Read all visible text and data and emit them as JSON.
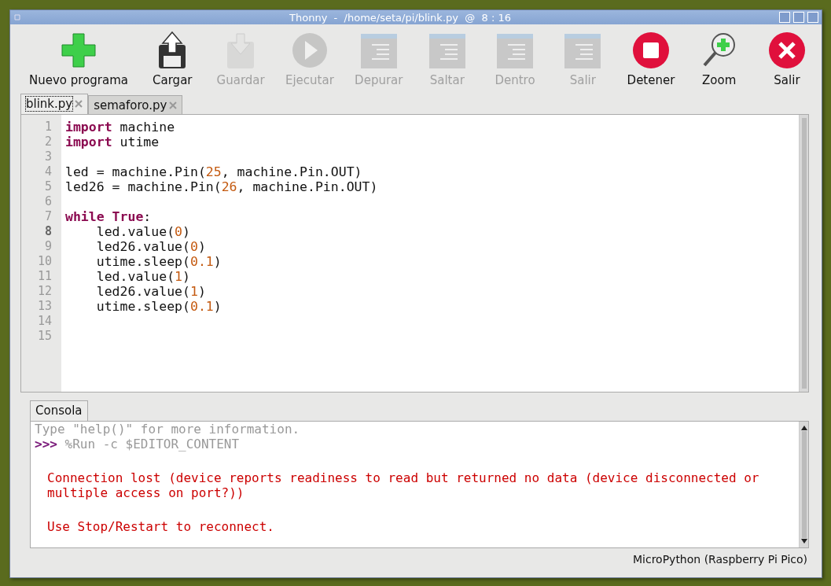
{
  "window": {
    "title": "Thonny  -  /home/seta/pi/blink.py  @  8 : 16"
  },
  "toolbar": [
    {
      "label": "Nuevo programa",
      "kind": "new",
      "disabled": false
    },
    {
      "label": "Cargar",
      "kind": "load",
      "disabled": false
    },
    {
      "label": "Guardar",
      "kind": "save",
      "disabled": true
    },
    {
      "label": "Ejecutar",
      "kind": "run",
      "disabled": true
    },
    {
      "label": "Depurar",
      "kind": "doc",
      "disabled": true
    },
    {
      "label": "Saltar",
      "kind": "doc",
      "disabled": true
    },
    {
      "label": "Dentro",
      "kind": "doc",
      "disabled": true
    },
    {
      "label": "Salir",
      "kind": "doc",
      "disabled": true
    },
    {
      "label": "Detener",
      "kind": "stop",
      "disabled": false
    },
    {
      "label": "Zoom",
      "kind": "zoom",
      "disabled": false
    },
    {
      "label": "Salir",
      "kind": "exit",
      "disabled": false
    }
  ],
  "editor_tabs": [
    {
      "label": "blink.py",
      "selected": true
    },
    {
      "label": "semaforo.py",
      "selected": false
    }
  ],
  "code_lines": [
    {
      "number": "1",
      "current": false,
      "tokens": [
        {
          "kind": "keyword",
          "text": "import"
        },
        {
          "kind": "plain",
          "text": " machine"
        }
      ]
    },
    {
      "number": "2",
      "current": false,
      "tokens": [
        {
          "kind": "keyword",
          "text": "import"
        },
        {
          "kind": "plain",
          "text": " utime"
        }
      ]
    },
    {
      "number": "3",
      "current": false
    },
    {
      "number": "4",
      "current": false,
      "tokens": [
        {
          "kind": "plain",
          "text": "led = machine.Pin("
        },
        {
          "kind": "number",
          "text": "25"
        },
        {
          "kind": "plain",
          "text": ", machine.Pin.OUT)"
        }
      ]
    },
    {
      "number": "5",
      "current": false,
      "tokens": [
        {
          "kind": "plain",
          "text": "led26 = machine.Pin("
        },
        {
          "kind": "number",
          "text": "26"
        },
        {
          "kind": "plain",
          "text": ", machine.Pin.OUT)"
        }
      ]
    },
    {
      "number": "6",
      "current": false
    },
    {
      "number": "7",
      "current": false,
      "tokens": [
        {
          "kind": "keyword",
          "text": "while True"
        },
        {
          "kind": "plain",
          "text": ":"
        }
      ]
    },
    {
      "number": "8",
      "current": true,
      "tokens": [
        {
          "kind": "plain",
          "text": "    led.value("
        },
        {
          "kind": "number",
          "text": "0"
        },
        {
          "kind": "plain",
          "text": ")"
        }
      ]
    },
    {
      "number": "9",
      "current": false,
      "tokens": [
        {
          "kind": "plain",
          "text": "    led26.value("
        },
        {
          "kind": "number",
          "text": "0"
        },
        {
          "kind": "plain",
          "text": ")"
        }
      ]
    },
    {
      "number": "10",
      "current": false,
      "tokens": [
        {
          "kind": "plain",
          "text": "    utime.sleep("
        },
        {
          "kind": "number",
          "text": "0.1"
        },
        {
          "kind": "plain",
          "text": ")"
        }
      ]
    },
    {
      "number": "11",
      "current": false,
      "tokens": [
        {
          "kind": "plain",
          "text": "    led.value("
        },
        {
          "kind": "number",
          "text": "1"
        },
        {
          "kind": "plain",
          "text": ")"
        }
      ]
    },
    {
      "number": "12",
      "current": false,
      "tokens": [
        {
          "kind": "plain",
          "text": "    led26.value("
        },
        {
          "kind": "number",
          "text": "1"
        },
        {
          "kind": "plain",
          "text": ")"
        }
      ]
    },
    {
      "number": "13",
      "current": false,
      "tokens": [
        {
          "kind": "plain",
          "text": "    utime.sleep("
        },
        {
          "kind": "number",
          "text": "0.1"
        },
        {
          "kind": "plain",
          "text": ")"
        }
      ]
    },
    {
      "number": "14",
      "current": false
    },
    {
      "number": "15",
      "current": false
    }
  ],
  "console_tab": {
    "label": "Consola",
    "selected": true
  },
  "console_lines": [
    {
      "kind": "info",
      "text": "Type \"help()\" for more information."
    },
    {
      "kind": "prompt",
      "prompt": ">>>",
      "text": " %Run -c $EDITOR_CONTENT"
    },
    {
      "kind": "blank"
    },
    {
      "kind": "error",
      "text": "Connection lost (device reports readiness to read but returned no data (device disconnected or multiple access on port?))"
    },
    {
      "kind": "blank"
    },
    {
      "kind": "error",
      "text": "Use Stop/Restart to reconnect."
    }
  ],
  "status_bar": {
    "interpreter": "MicroPython (Raspberry Pi Pico)"
  }
}
